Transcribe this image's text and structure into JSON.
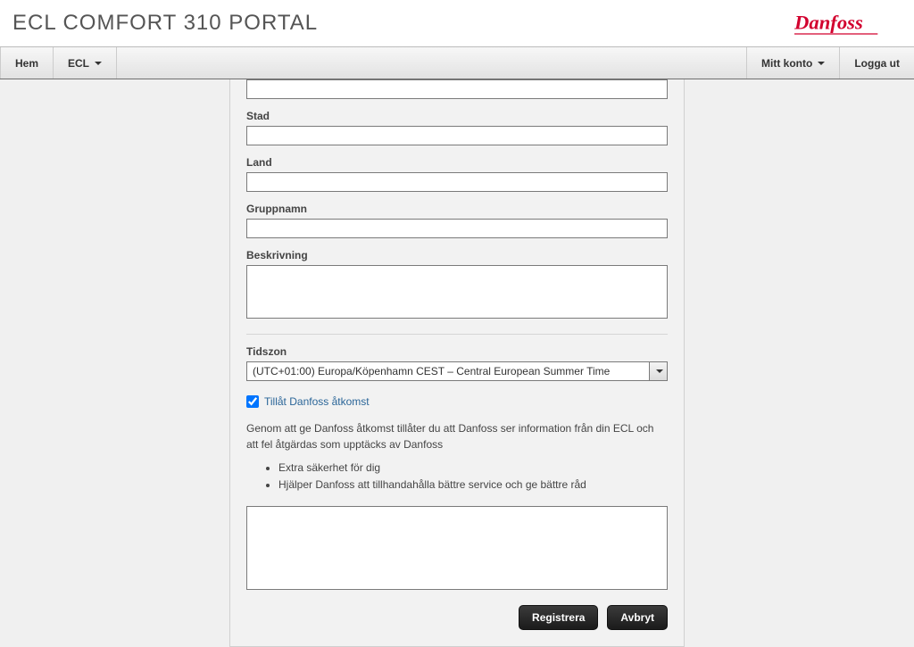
{
  "header": {
    "title": "ECL COMFORT 310 PORTAL"
  },
  "nav": {
    "left": [
      {
        "label": "Hem",
        "dropdown": false
      },
      {
        "label": "ECL",
        "dropdown": true
      }
    ],
    "right": [
      {
        "label": "Mitt konto",
        "dropdown": true
      },
      {
        "label": "Logga ut",
        "dropdown": false
      }
    ]
  },
  "form": {
    "field_top_value": "",
    "city_label": "Stad",
    "city_value": "",
    "country_label": "Land",
    "country_value": "",
    "group_label": "Gruppnamn",
    "group_value": "",
    "description_label": "Beskrivning",
    "description_value": "",
    "timezone_label": "Tidszon",
    "timezone_value": "(UTC+01:00) Europa/Köpenhamn CEST – Central European Summer Time",
    "access_checkbox_label": "Tillåt Danfoss åtkomst",
    "access_checked": true,
    "access_info_para": "Genom att ge Danfoss åtkomst tillåter du att Danfoss ser information från din ECL och att fel åtgärdas som upptäcks av Danfoss",
    "access_bullets": [
      "Extra säkerhet för dig",
      "Hjälper Danfoss att tillhandahålla bättre service och ge bättre råd"
    ],
    "notes_value": "",
    "register_label": "Registrera",
    "cancel_label": "Avbryt"
  }
}
